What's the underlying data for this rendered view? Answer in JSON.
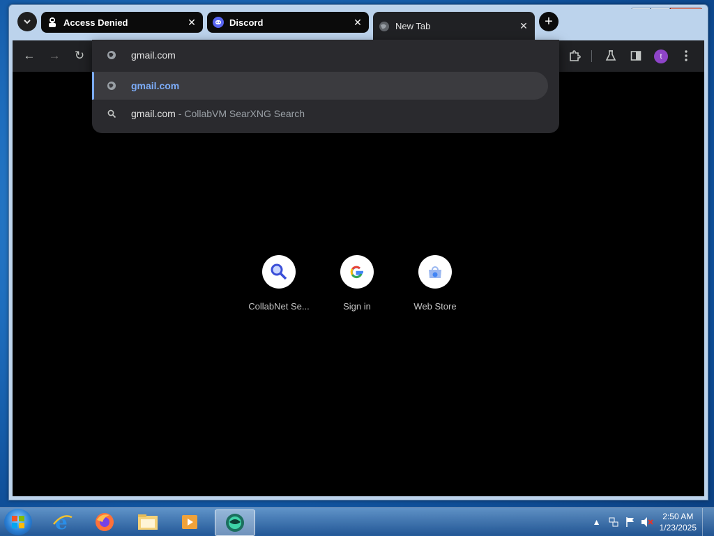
{
  "window": {
    "controls": {
      "minimize": "▁",
      "maximize": "☐",
      "close": "✕"
    }
  },
  "tabs": {
    "search_tabs_icon": "chevron-down",
    "items": [
      {
        "title": "Access Denied",
        "close": "✕"
      },
      {
        "title": "Discord",
        "close": "✕"
      },
      {
        "title": "New Tab",
        "close": "✕"
      }
    ],
    "new_tab": "+"
  },
  "toolbar": {
    "back": "←",
    "forward": "→",
    "reload": "↻",
    "avatar_initial": "t"
  },
  "omnibox": {
    "value": "gmail.com",
    "suggestions": [
      {
        "main": "gmail.com",
        "sub": ""
      },
      {
        "main": "gmail.com",
        "sub": "- CollabVM SearXNG Search"
      }
    ]
  },
  "shortcuts": [
    {
      "label": "CollabNet Se..."
    },
    {
      "label": "Sign in"
    },
    {
      "label": "Web Store"
    }
  ],
  "taskbar": {
    "clock_time": "2:50 AM",
    "clock_date": "1/23/2025"
  },
  "colors": {
    "accent": "#7cacf8",
    "avatar": "#8e44c8",
    "toolbar": "#202124"
  }
}
